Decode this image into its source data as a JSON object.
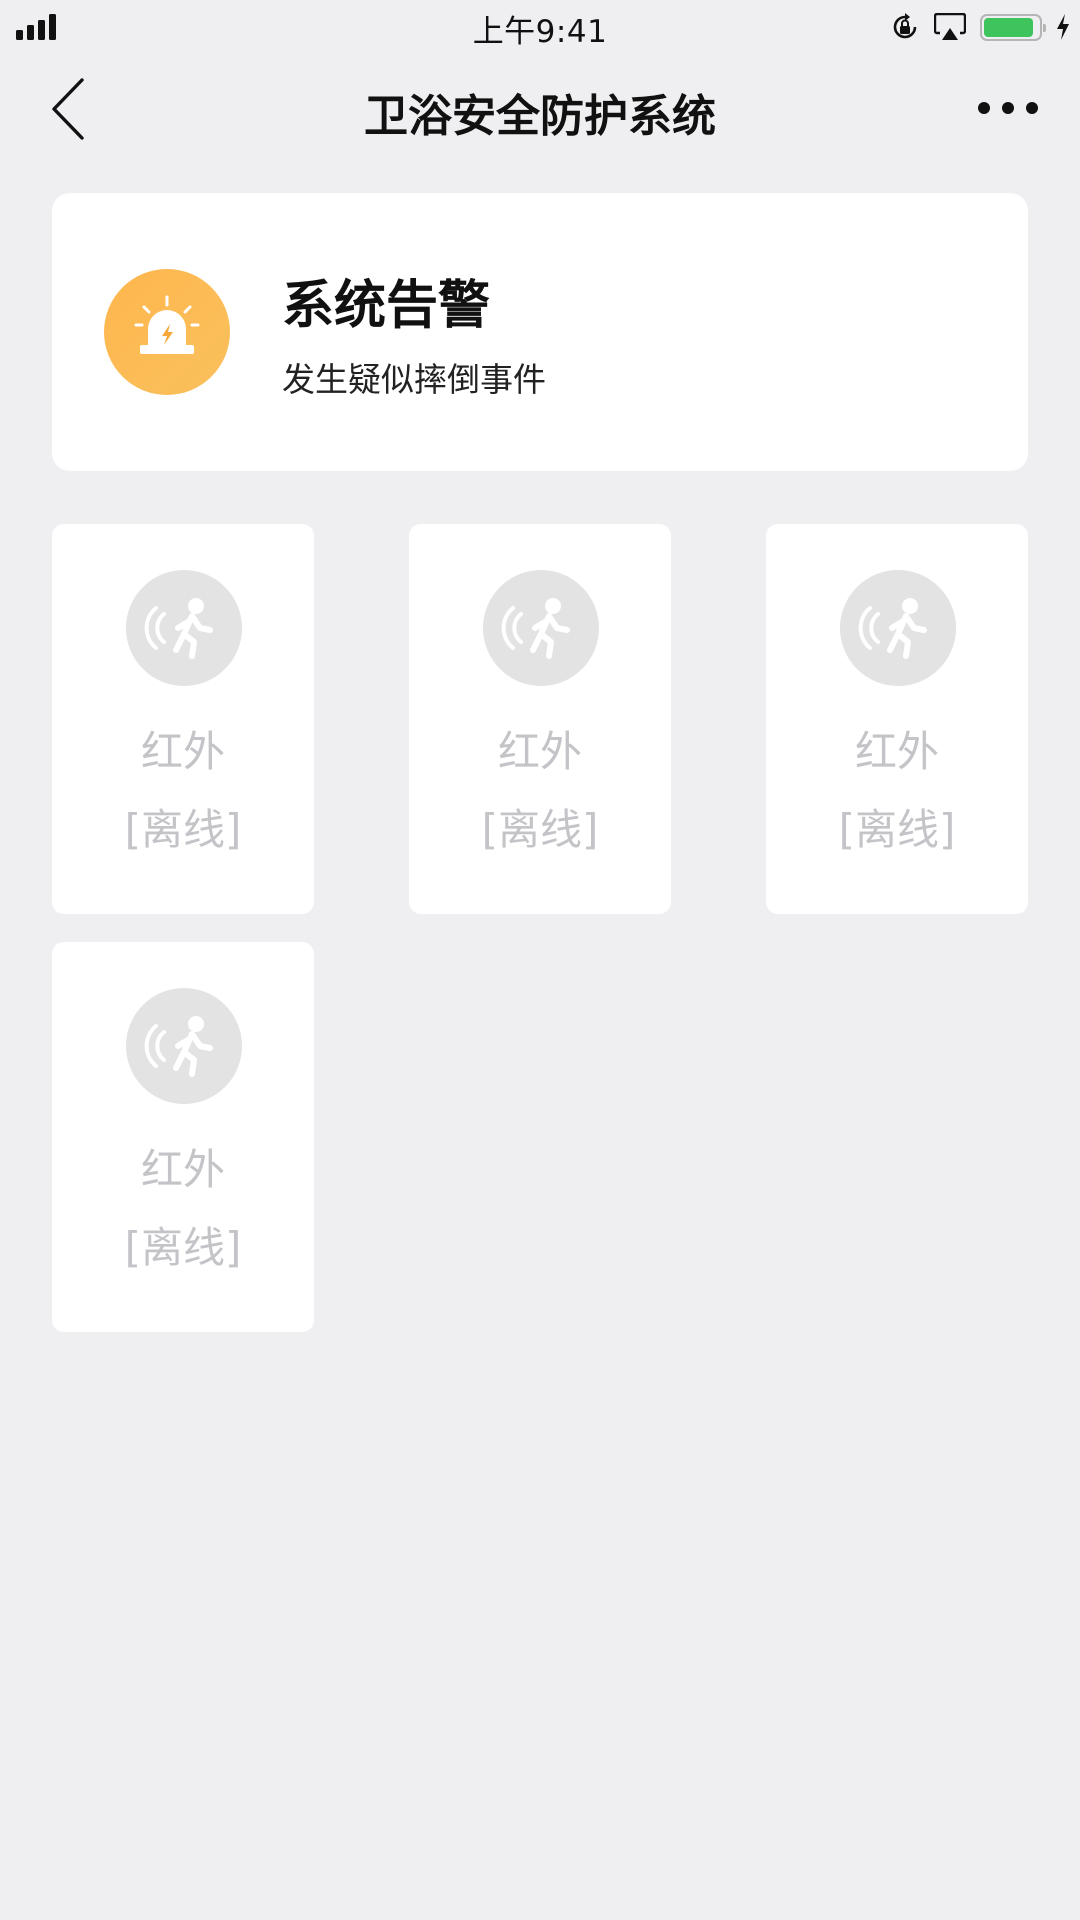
{
  "status_bar": {
    "time": "上午9:41",
    "battery_level": 0.92,
    "colors": {
      "battery": "#3ec45c"
    },
    "icons": [
      "signal-icon",
      "orientation-lock-icon",
      "airplay-icon",
      "battery-icon",
      "charging-icon"
    ]
  },
  "nav": {
    "title": "卫浴安全防护系统",
    "icons": [
      "back-icon",
      "more-icon"
    ]
  },
  "alert": {
    "title": "系统告警",
    "message": "发生疑似摔倒事件",
    "icon": "alarm-siren-icon",
    "colors": {
      "icon_bg": "#ffb64e"
    }
  },
  "devices": [
    {
      "name": "红外",
      "status": "[离线]",
      "icon": "infrared-motion-sensor-icon"
    },
    {
      "name": "红外",
      "status": "[离线]",
      "icon": "infrared-motion-sensor-icon"
    },
    {
      "name": "红外",
      "status": "[离线]",
      "icon": "infrared-motion-sensor-icon"
    },
    {
      "name": "红外",
      "status": "[离线]",
      "icon": "infrared-motion-sensor-icon"
    }
  ]
}
